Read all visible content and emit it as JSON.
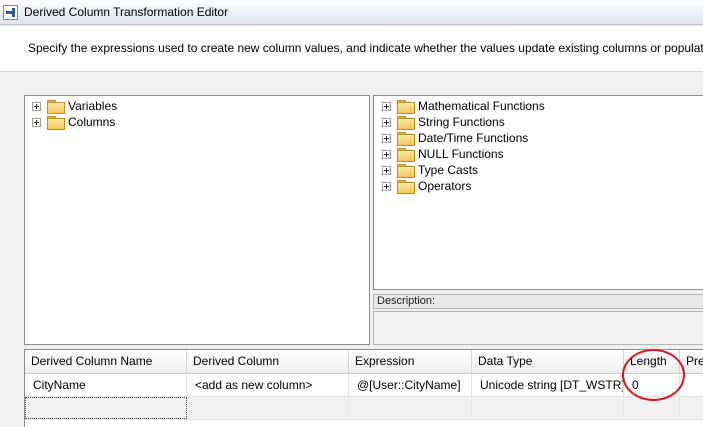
{
  "window": {
    "title": "Derived Column Transformation Editor"
  },
  "header": {
    "description": "Specify the expressions used to create new column values, and indicate whether the values update existing columns or populate n"
  },
  "left_tree": {
    "items": [
      {
        "label": "Variables"
      },
      {
        "label": "Columns"
      }
    ]
  },
  "right_tree": {
    "items": [
      {
        "label": "Mathematical Functions"
      },
      {
        "label": "String Functions"
      },
      {
        "label": "Date/Time Functions"
      },
      {
        "label": "NULL Functions"
      },
      {
        "label": "Type Casts"
      },
      {
        "label": "Operators"
      }
    ]
  },
  "description_panel": {
    "label": "Description:"
  },
  "grid": {
    "columns": [
      "Derived Column Name",
      "Derived Column",
      "Expression",
      "Data Type",
      "Length",
      "Pre"
    ],
    "rows": [
      {
        "name": "CityName",
        "derived_column": "<add as new column>",
        "expression": "@[User::CityName]",
        "data_type": "Unicode string [DT_WSTR]",
        "length": "0",
        "precision": ""
      }
    ]
  },
  "annotation": {
    "color": "#e0141c"
  }
}
